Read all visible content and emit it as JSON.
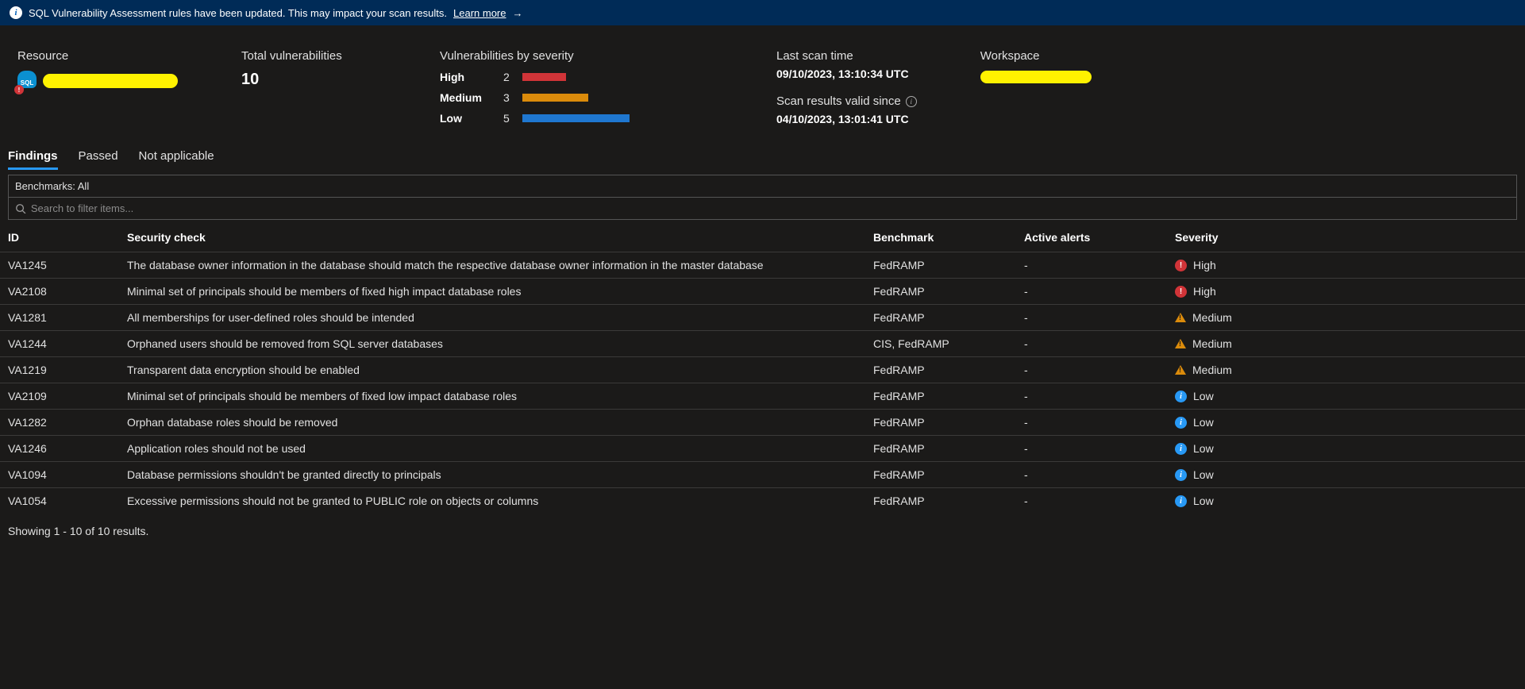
{
  "banner": {
    "text": "SQL Vulnerability Assessment rules have been updated. This may impact your scan results.",
    "link": "Learn more"
  },
  "summary": {
    "resource_label": "Resource",
    "sql_text": "SQL",
    "total_label": "Total vulnerabilities",
    "total_value": "10",
    "severity_label": "Vulnerabilities by severity",
    "severity": {
      "high_label": "High",
      "high_count": "2",
      "med_label": "Medium",
      "med_count": "3",
      "low_label": "Low",
      "low_count": "5"
    },
    "last_scan_label": "Last scan time",
    "last_scan_value": "09/10/2023, 13:10:34 UTC",
    "valid_since_label": "Scan results valid since",
    "valid_since_value": "04/10/2023, 13:01:41 UTC",
    "workspace_label": "Workspace"
  },
  "tabs": {
    "findings": "Findings",
    "passed": "Passed",
    "na": "Not applicable"
  },
  "filters": {
    "benchmark": "Benchmarks: All",
    "search_placeholder": "Search to filter items..."
  },
  "headers": {
    "id": "ID",
    "check": "Security check",
    "benchmark": "Benchmark",
    "alerts": "Active alerts",
    "severity": "Severity"
  },
  "rows": [
    {
      "id": "VA1245",
      "check": "The database owner information in the database should match the respective database owner information in the master database",
      "benchmark": "FedRAMP",
      "alerts": "-",
      "severity": "High"
    },
    {
      "id": "VA2108",
      "check": "Minimal set of principals should be members of fixed high impact database roles",
      "benchmark": "FedRAMP",
      "alerts": "-",
      "severity": "High"
    },
    {
      "id": "VA1281",
      "check": "All memberships for user-defined roles should be intended",
      "benchmark": "FedRAMP",
      "alerts": "-",
      "severity": "Medium"
    },
    {
      "id": "VA1244",
      "check": "Orphaned users should be removed from SQL server databases",
      "benchmark": "CIS, FedRAMP",
      "alerts": "-",
      "severity": "Medium"
    },
    {
      "id": "VA1219",
      "check": "Transparent data encryption should be enabled",
      "benchmark": "FedRAMP",
      "alerts": "-",
      "severity": "Medium"
    },
    {
      "id": "VA2109",
      "check": "Minimal set of principals should be members of fixed low impact database roles",
      "benchmark": "FedRAMP",
      "alerts": "-",
      "severity": "Low"
    },
    {
      "id": "VA1282",
      "check": "Orphan database roles should be removed",
      "benchmark": "FedRAMP",
      "alerts": "-",
      "severity": "Low"
    },
    {
      "id": "VA1246",
      "check": "Application roles should not be used",
      "benchmark": "FedRAMP",
      "alerts": "-",
      "severity": "Low"
    },
    {
      "id": "VA1094",
      "check": "Database permissions shouldn't be granted directly to principals",
      "benchmark": "FedRAMP",
      "alerts": "-",
      "severity": "Low"
    },
    {
      "id": "VA1054",
      "check": "Excessive permissions should not be granted to PUBLIC role on objects or columns",
      "benchmark": "FedRAMP",
      "alerts": "-",
      "severity": "Low"
    }
  ],
  "footer": "Showing 1 - 10 of 10 results.",
  "chart_data": {
    "type": "bar",
    "title": "Vulnerabilities by severity",
    "categories": [
      "High",
      "Medium",
      "Low"
    ],
    "values": [
      2,
      3,
      5
    ],
    "colors": [
      "#d13438",
      "#db8b0b",
      "#1f77d0"
    ]
  }
}
